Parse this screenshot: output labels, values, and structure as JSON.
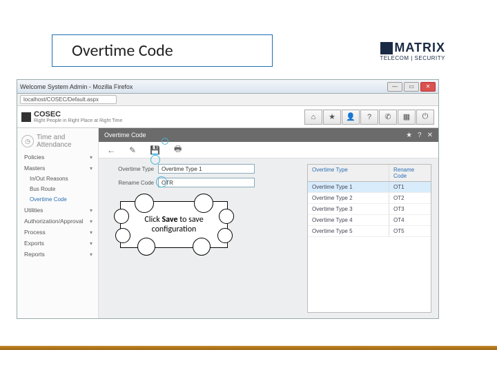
{
  "slide": {
    "title": "Overtime Code",
    "logo_main": "MATRIX",
    "logo_sub": "TELECOM | SECURITY"
  },
  "window": {
    "title": "Welcome System Admin - Mozilla Firefox",
    "url": "localhost/COSEC/Default.aspx",
    "brand": "COSEC",
    "brand_tag": "Right People in Right Place at Right Time",
    "win_min": "—",
    "win_max": "▭",
    "win_close": "✕"
  },
  "top_icons": {
    "home": "⌂",
    "star": "★",
    "user": "👤",
    "help": "?",
    "phone": "✆",
    "grid": "▦",
    "power": "⏻"
  },
  "sidebar": {
    "section_title": "Time and",
    "section_sub": "Attendance",
    "items": [
      {
        "label": "Policies",
        "chev": "▾"
      },
      {
        "label": "Masters",
        "chev": "▾"
      },
      {
        "label": "In/Out Reasons",
        "sub": true
      },
      {
        "label": "Bus Route",
        "sub": true
      },
      {
        "label": "Overtime Code",
        "sub": true,
        "active": true
      },
      {
        "label": "Utilities",
        "chev": "▾"
      },
      {
        "label": "Authorization/Approval",
        "chev": "▾"
      },
      {
        "label": "Process",
        "chev": "▾"
      },
      {
        "label": "Exports",
        "chev": "▾"
      },
      {
        "label": "Reports",
        "chev": "▾"
      }
    ]
  },
  "page": {
    "title": "Overtime Code",
    "icons": {
      "star": "★",
      "help": "?",
      "close": "✕"
    }
  },
  "toolbar": {
    "back": "←",
    "edit": "✎",
    "save": "💾",
    "print": "🖶"
  },
  "form": {
    "type_label": "Overtime Type",
    "type_value": "Overtime Type 1",
    "code_label": "Rename Code",
    "code_value": "OTR"
  },
  "list": {
    "col_a": "Overtime Type",
    "col_b": "Rename Code",
    "rows": [
      {
        "a": "Overtime Type 1",
        "b": "OT1",
        "sel": true
      },
      {
        "a": "Overtime Type 2",
        "b": "OT2"
      },
      {
        "a": "Overtime Type 3",
        "b": "OT3"
      },
      {
        "a": "Overtime Type 4",
        "b": "OT4"
      },
      {
        "a": "Overtime Type 5",
        "b": "OT5"
      }
    ]
  },
  "callout": {
    "pre": "Click ",
    "bold": "Save",
    "post": " to save configuration"
  }
}
